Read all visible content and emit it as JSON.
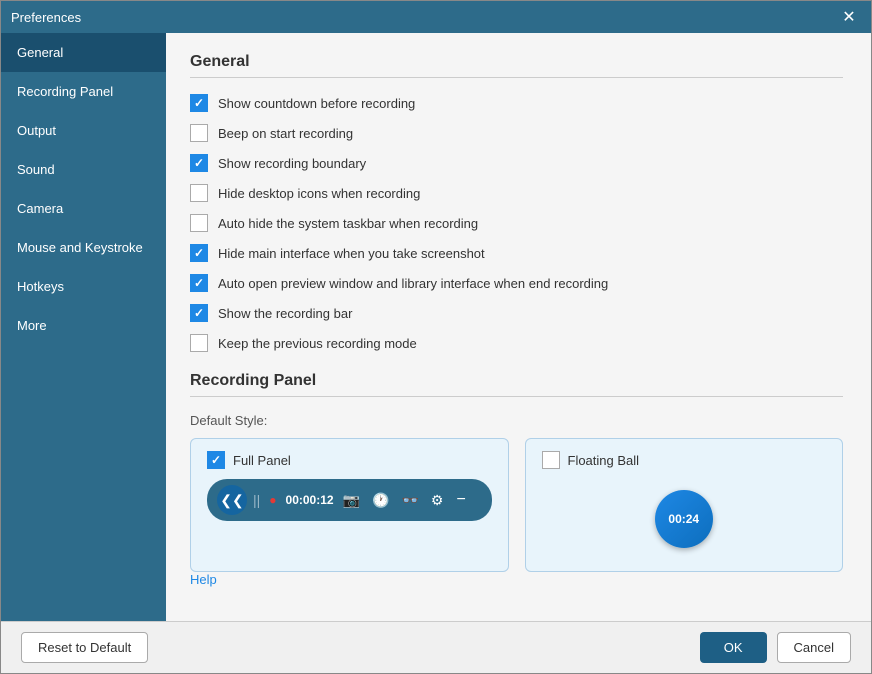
{
  "window": {
    "title": "Preferences",
    "close_label": "✕"
  },
  "sidebar": {
    "items": [
      {
        "id": "general",
        "label": "General",
        "active": true
      },
      {
        "id": "recording-panel",
        "label": "Recording Panel",
        "active": false
      },
      {
        "id": "output",
        "label": "Output",
        "active": false
      },
      {
        "id": "sound",
        "label": "Sound",
        "active": false
      },
      {
        "id": "camera",
        "label": "Camera",
        "active": false
      },
      {
        "id": "mouse-keystroke",
        "label": "Mouse and Keystroke",
        "active": false
      },
      {
        "id": "hotkeys",
        "label": "Hotkeys",
        "active": false
      },
      {
        "id": "more",
        "label": "More",
        "active": false
      }
    ]
  },
  "general": {
    "section_title": "General",
    "checkboxes": [
      {
        "id": "countdown",
        "label": "Show countdown before recording",
        "checked": true
      },
      {
        "id": "beep",
        "label": "Beep on start recording",
        "checked": false
      },
      {
        "id": "boundary",
        "label": "Show recording boundary",
        "checked": true
      },
      {
        "id": "hide-icons",
        "label": "Hide desktop icons when recording",
        "checked": false
      },
      {
        "id": "hide-taskbar",
        "label": "Auto hide the system taskbar when recording",
        "checked": false
      },
      {
        "id": "hide-interface",
        "label": "Hide main interface when you take screenshot",
        "checked": true
      },
      {
        "id": "auto-open",
        "label": "Auto open preview window and library interface when end recording",
        "checked": true
      },
      {
        "id": "recording-bar",
        "label": "Show the recording bar",
        "checked": true
      },
      {
        "id": "keep-mode",
        "label": "Keep the previous recording mode",
        "checked": false
      }
    ]
  },
  "recording_panel": {
    "section_title": "Recording Panel",
    "default_style_label": "Default Style:",
    "full_panel": {
      "label": "Full Panel",
      "checked": true,
      "time": "00:00:12"
    },
    "floating_ball": {
      "label": "Floating Ball",
      "checked": false,
      "time": "00:24"
    }
  },
  "footer": {
    "reset_label": "Reset to Default",
    "ok_label": "OK",
    "cancel_label": "Cancel"
  },
  "help": {
    "label": "Help"
  }
}
